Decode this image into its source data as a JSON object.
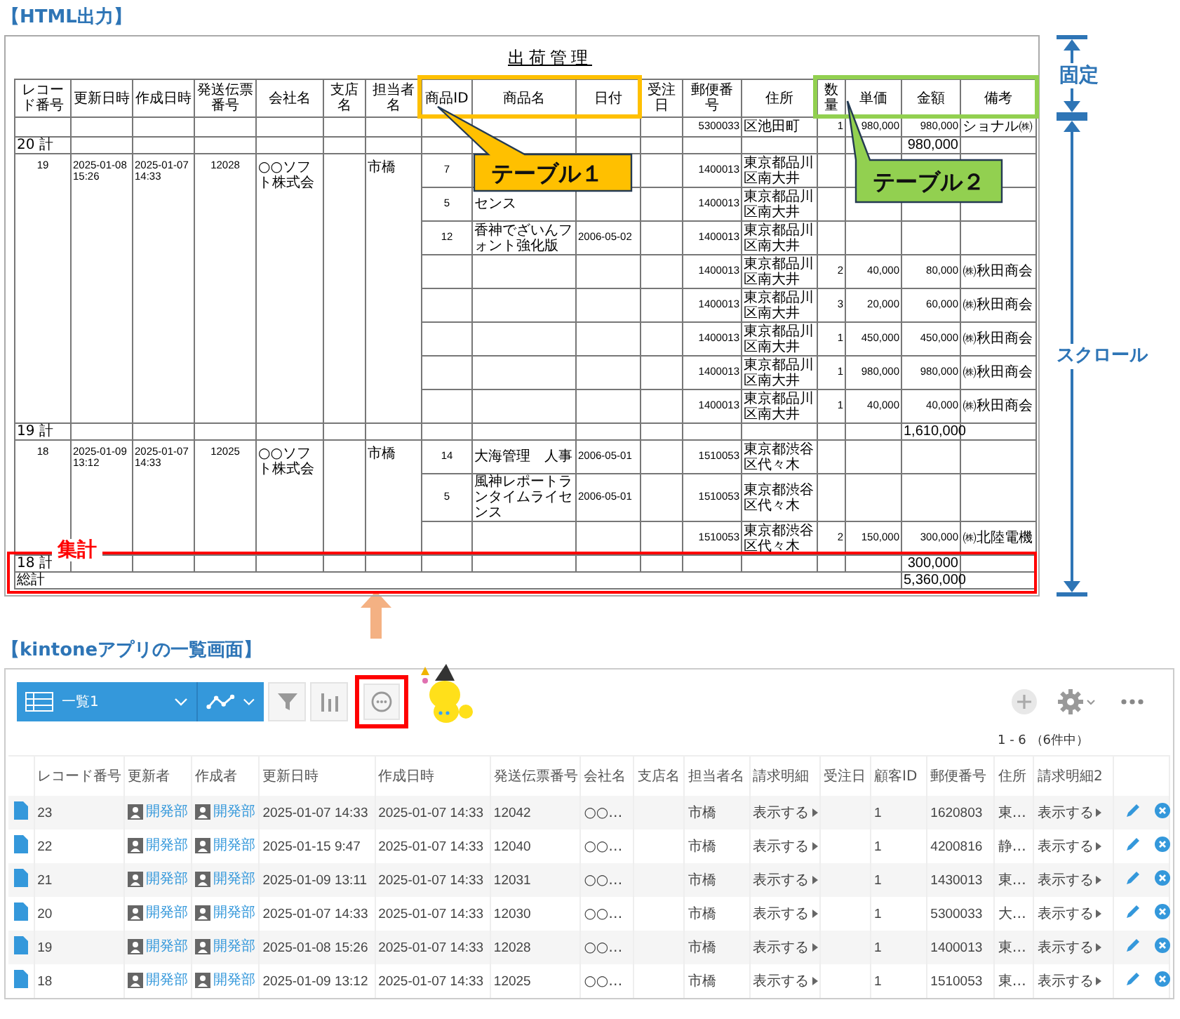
{
  "report_section": {
    "heading": "【HTML出力】"
  },
  "report": {
    "title": "出荷管理",
    "columns": [
      "レコード番号",
      "更新日時",
      "作成日時",
      "発送伝票番号",
      "会社名",
      "支店名",
      "担当者名",
      "商品ID",
      "商品名",
      "日付",
      "受注日",
      "郵便番号",
      "住所",
      "数量",
      "単価",
      "金額",
      "備考"
    ],
    "groups": [
      {
        "items": [
          {
            "postal_code": "5300033",
            "address": "区池田町",
            "quantity": "1",
            "unit_price": "980,000",
            "amount": "980,000",
            "note": "ショナル㈱"
          }
        ],
        "subtotal": {
          "label": "20 計",
          "amount": "980,000"
        }
      },
      {
        "record": {
          "record_no": "19",
          "updated_at": "2025-01-08 15:26",
          "created_at": "2025-01-07 14:33",
          "slip_no": "12028",
          "company": "○○ソフト株式会",
          "person": "市橋"
        },
        "items": [
          {
            "product_id": "7",
            "postal_code": "1400013",
            "address": "東京都品川区南大井"
          },
          {
            "product_id": "5",
            "product_name": "センス",
            "postal_code": "1400013",
            "address": "東京都品川区南大井"
          },
          {
            "product_id": "12",
            "product_name": "香神でざいんフォント強化版",
            "date": "2006-05-02",
            "postal_code": "1400013",
            "address": "東京都品川区南大井"
          },
          {
            "postal_code": "1400013",
            "address": "東京都品川区南大井",
            "quantity": "2",
            "unit_price": "40,000",
            "amount": "80,000",
            "note": "㈱秋田商会"
          },
          {
            "postal_code": "1400013",
            "address": "東京都品川区南大井",
            "quantity": "3",
            "unit_price": "20,000",
            "amount": "60,000",
            "note": "㈱秋田商会"
          },
          {
            "postal_code": "1400013",
            "address": "東京都品川区南大井",
            "quantity": "1",
            "unit_price": "450,000",
            "amount": "450,000",
            "note": "㈱秋田商会"
          },
          {
            "postal_code": "1400013",
            "address": "東京都品川区南大井",
            "quantity": "1",
            "unit_price": "980,000",
            "amount": "980,000",
            "note": "㈱秋田商会"
          },
          {
            "postal_code": "1400013",
            "address": "東京都品川区南大井",
            "quantity": "1",
            "unit_price": "40,000",
            "amount": "40,000",
            "note": "㈱秋田商会"
          }
        ],
        "subtotal": {
          "label": "19 計",
          "amount": "1,610,000"
        }
      },
      {
        "record": {
          "record_no": "18",
          "updated_at": "2025-01-09 13:12",
          "created_at": "2025-01-07 14:33",
          "slip_no": "12025",
          "company": "○○ソフト株式会",
          "person": "市橋"
        },
        "items": [
          {
            "product_id": "14",
            "product_name": "大海管理　人事",
            "date": "2006-05-01",
            "postal_code": "1510053",
            "address": "東京都渋谷区代々木"
          },
          {
            "product_id": "5",
            "product_name": "風神レポートランタイムライセンス",
            "date": "2006-05-01",
            "postal_code": "1510053",
            "address": "東京都渋谷区代々木"
          },
          {
            "postal_code": "1510053",
            "address": "東京都渋谷区代々木",
            "quantity": "2",
            "unit_price": "150,000",
            "amount": "300,000",
            "note": "㈱北陸電機"
          }
        ],
        "subtotal": {
          "label": "18 計",
          "amount": "300,000"
        }
      }
    ],
    "grand_total": {
      "label": "総計",
      "amount": "5,360,000"
    }
  },
  "callouts": [
    {
      "label": "テーブル１",
      "color": "#ffc000"
    },
    {
      "label": "テーブル２",
      "color": "#92d050"
    }
  ],
  "total_frame": {
    "label": "集計"
  },
  "range_markers": [
    {
      "label": "固定"
    },
    {
      "label": "スクロール"
    }
  ],
  "list_section": {
    "heading": "【kintoneアプリの一覧画面】"
  },
  "kintone": {
    "view_name": "一覧1",
    "count": "1 - 6 （6件中）",
    "columns": [
      "レコード番号",
      "更新者",
      "作成者",
      "更新日時",
      "作成日時",
      "発送伝票番号",
      "会社名",
      "支店名",
      "担当者名",
      "請求明細",
      "受注日",
      "顧客ID",
      "郵便番号",
      "住所",
      "請求明細2"
    ],
    "rows": [
      {
        "record_no": "23",
        "updated_by": "開発部",
        "created_by": "開発部",
        "updated_at": "2025-01-07 14:33",
        "created_at": "2025-01-07 14:33",
        "slip_no": "12042",
        "company": "○○…",
        "person": "市橋",
        "invoice": "表示する",
        "customer_id": "1",
        "postal_code": "1620803",
        "address": "東…",
        "invoice2": "表示する"
      },
      {
        "record_no": "22",
        "updated_by": "開発部",
        "created_by": "開発部",
        "updated_at": "2025-01-15 9:47",
        "created_at": "2025-01-07 14:33",
        "slip_no": "12040",
        "company": "○○…",
        "person": "市橋",
        "invoice": "表示する",
        "customer_id": "1",
        "postal_code": "4200816",
        "address": "静…",
        "invoice2": "表示する"
      },
      {
        "record_no": "21",
        "updated_by": "開発部",
        "created_by": "開発部",
        "updated_at": "2025-01-09 13:11",
        "created_at": "2025-01-07 14:33",
        "slip_no": "12031",
        "company": "○○…",
        "person": "市橋",
        "invoice": "表示する",
        "customer_id": "1",
        "postal_code": "1430013",
        "address": "東…",
        "invoice2": "表示する"
      },
      {
        "record_no": "20",
        "updated_by": "開発部",
        "created_by": "開発部",
        "updated_at": "2025-01-07 14:33",
        "created_at": "2025-01-07 14:33",
        "slip_no": "12030",
        "company": "○○…",
        "person": "市橋",
        "invoice": "表示する",
        "customer_id": "1",
        "postal_code": "5300033",
        "address": "大…",
        "invoice2": "表示する"
      },
      {
        "record_no": "19",
        "updated_by": "開発部",
        "created_by": "開発部",
        "updated_at": "2025-01-08 15:26",
        "created_at": "2025-01-07 14:33",
        "slip_no": "12028",
        "company": "○○…",
        "person": "市橋",
        "invoice": "表示する",
        "customer_id": "1",
        "postal_code": "1400013",
        "address": "東…",
        "invoice2": "表示する"
      },
      {
        "record_no": "18",
        "updated_by": "開発部",
        "created_by": "開発部",
        "updated_at": "2025-01-09 13:12",
        "created_at": "2025-01-07 14:33",
        "slip_no": "12025",
        "company": "○○…",
        "person": "市橋",
        "invoice": "表示する",
        "customer_id": "1",
        "postal_code": "1510053",
        "address": "東…",
        "invoice2": "表示する"
      }
    ]
  }
}
